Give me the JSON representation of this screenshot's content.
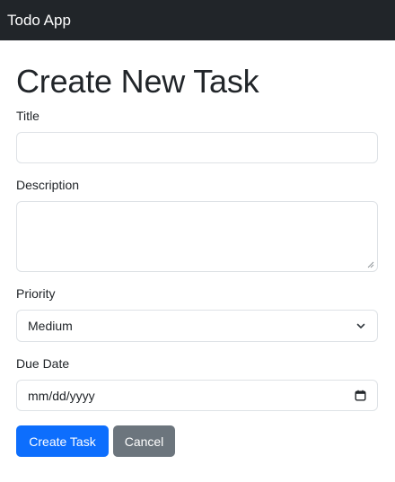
{
  "navbar": {
    "brand": "Todo App"
  },
  "page": {
    "title": "Create New Task"
  },
  "form": {
    "title": {
      "label": "Title",
      "value": ""
    },
    "description": {
      "label": "Description",
      "value": ""
    },
    "priority": {
      "label": "Priority",
      "selected": "Medium",
      "icon": "chevron-down-icon"
    },
    "due_date": {
      "label": "Due Date",
      "placeholder": "mm/dd/yyyy",
      "icon": "calendar-icon"
    },
    "submit_label": "Create Task",
    "cancel_label": "Cancel"
  },
  "colors": {
    "navbar_bg": "#212529",
    "primary": "#0d6efd",
    "secondary": "#6c757d",
    "border": "#dee2e6"
  }
}
